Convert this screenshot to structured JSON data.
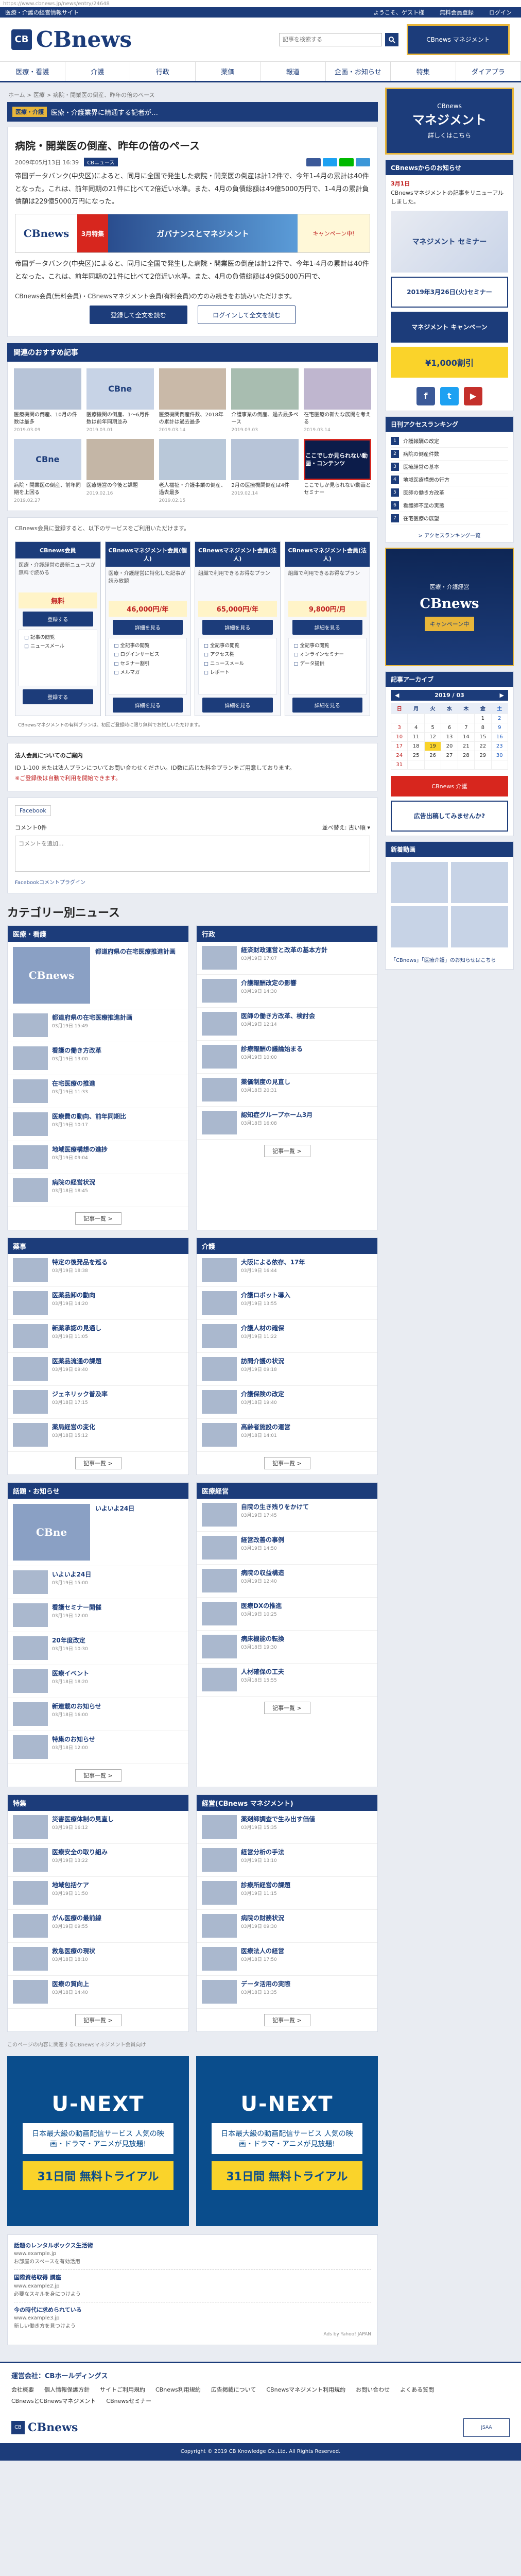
{
  "url": "https://www.cbnews.jp/news/entry/24648",
  "topbar": {
    "left": "医療・介護の経営情報サイト",
    "links": [
      "ようこそ、ゲスト様",
      "無料会員登録",
      "ログイン"
    ]
  },
  "header": {
    "logo": "CBnews",
    "search_placeholder": "記事を検索する",
    "right_banner": "CBnews マネジメント"
  },
  "nav": [
    "医療・看護",
    "介護",
    "行政",
    "薬価",
    "報道",
    "企画・お知らせ",
    "特集",
    "ダイアプラ"
  ],
  "breadcrumb": "ホーム > 医療 > 病院・開業医の倒産、昨年の倍のペース",
  "adbar": {
    "badge": "医療・介護",
    "text": "医療・介護業界に精通する記者が…"
  },
  "article": {
    "title": "病院・開業医の倒産、昨年の倍のペース",
    "date": "2009年05月13日 16:39",
    "tag": "CBニュース",
    "p1": "帝国データバンク(中央区)によると、同月に全国で発生した病院・開業医の倒産は計12件で、今年1-4月の累計は40件となった。これは、前年同期の21件に比べて2倍近い水準。また、4月の負債総額は49億5000万円で、1-4月の累計負債額は229億5000万円になった。",
    "p2": "帝国データバンク(中央区)によると、同月に全国で発生した病院・開業医の倒産は計12件で、今年1-4月の累計は40件となった。これは、前年同期の21件に比べて2倍近い水準。また、4月の負債総額は49億5000万円で、",
    "banner_logo": "CBnews",
    "banner_badge": "3月特集",
    "banner_main": "ガバナンスとマネジメント",
    "banner_extra": "キャンペーン中!",
    "notice": "CBnews会員(無料会員)・CBnewsマネジメント会員(有料会員)の方のみ続きをお読みいただけます。",
    "btn_register": "登録して全文を読む",
    "btn_login": "ログインして全文を読む"
  },
  "recommend": {
    "title": "関連のおすすめ記事",
    "items": [
      {
        "thumb": "",
        "text": "医療機関の倒産、10月の件数は最多",
        "date": "2019.03.09"
      },
      {
        "thumb": "CBne",
        "text": "医療機関の倒産、1〜6月件数は前年同期並み",
        "date": "2019.03.01"
      },
      {
        "thumb": "",
        "text": "医療機関倒産件数、2018年の累計は過去最多",
        "date": "2019.03.14"
      },
      {
        "thumb": "",
        "text": "介護事業の倒産、過去最多ペース",
        "date": "2019.03.03"
      },
      {
        "thumb": "",
        "text": "在宅医療の新たな展開を考える",
        "date": "2019.03.14"
      },
      {
        "thumb": "CBne",
        "text": "病院・開業医の倒産、前年同期を上回る",
        "date": "2019.02.27"
      },
      {
        "thumb": "",
        "text": "医療経営の今後と課題",
        "date": "2019.02.16"
      },
      {
        "thumb": "",
        "text": "老人福祉・介護事業の倒産、過去最多",
        "date": "2019.02.15"
      },
      {
        "thumb": "",
        "text": "2月の医療機関倒産は4件",
        "date": "2019.02.14"
      },
      {
        "thumb": "ここでしか見られない動画・コンテンツ",
        "text": "ここでしか見られない動画とセミナー",
        "date": ""
      }
    ]
  },
  "plans": {
    "intro": "CBnews会員に登録すると、以下のサービスをご利用いただけます。",
    "headers": [
      "CBnews会員",
      "CBnewsマネジメント会員(個人)",
      "CBnewsマネジメント会員(法人)",
      "CBnewsマネジメント会員(法人)"
    ],
    "subs": [
      "医療・介護経営の最新ニュースが無料で読める",
      "医療・介護経営に特化した記事が読み放題",
      "組織で利用できるお得なプラン",
      "組織で利用できるお得なプラン"
    ],
    "prices": [
      "無料",
      "46,000円/年",
      "65,000円/年",
      "9,800円/月"
    ],
    "cta": [
      "登録する",
      "詳細を見る",
      "詳細を見る",
      "詳細を見る"
    ],
    "lists": [
      [
        "記事の閲覧",
        "ニュースメール"
      ],
      [
        "全記事の閲覧",
        "ログインサービス",
        "セミナー割引",
        "メルマガ"
      ],
      [
        "全記事の閲覧",
        "アクセス権",
        "ニュースメール",
        "レポート"
      ],
      [
        "全記事の閲覧",
        "オンラインセミナー",
        "データ提供"
      ]
    ],
    "bottom_note": "CBnewsマネジメントの有料プランは、初回ご登録時に限り無料でお試しいただけます。"
  },
  "contact": {
    "title": "法人会員についてのご案内",
    "text": "ID 1-100 または法人プランについてお問い合わせください。ID数に応じた料金プランをご用意しております。",
    "note": "※ご登録後は自動で利用を開始できます。"
  },
  "comments": {
    "fb": "Facebook",
    "count": "コメント0件",
    "sort": "並べ替え",
    "sort_val": "古い順",
    "placeholder": "コメントを追加...",
    "plugin": "Facebookコメントプラグイン"
  },
  "categories": {
    "title": "カテゴリー別ニュース",
    "boxes": [
      {
        "name": "医療・看護",
        "feat": "CBnews",
        "items": [
          {
            "t": "都道府県の在宅医療推進計画",
            "d": "03月19日 15:49"
          },
          {
            "t": "看護の働き方改革",
            "d": "03月19日 13:00"
          },
          {
            "t": "在宅医療の推進",
            "d": "03月19日 11:33"
          },
          {
            "t": "医療費の動向、前年同期比",
            "d": "03月19日 10:17"
          },
          {
            "t": "地域医療構想の進捗",
            "d": "03月19日 09:04"
          },
          {
            "t": "病院の経営状況",
            "d": "03月18日 18:45"
          }
        ]
      },
      {
        "name": "行政",
        "feat": "",
        "items": [
          {
            "t": "経済財政運営と改革の基本方針",
            "d": "03月19日 17:07"
          },
          {
            "t": "介護報酬改定の影響",
            "d": "03月19日 14:30"
          },
          {
            "t": "医師の働き方改革、検討会",
            "d": "03月19日 12:14"
          },
          {
            "t": "診療報酬の議論始まる",
            "d": "03月19日 10:00"
          },
          {
            "t": "薬価制度の見直し",
            "d": "03月18日 20:31"
          },
          {
            "t": "認知症グループホーム3月",
            "d": "03月18日 16:08"
          }
        ]
      },
      {
        "name": "薬事",
        "feat": "",
        "items": [
          {
            "t": "特定の後発品を巡る",
            "d": "03月19日 18:38"
          },
          {
            "t": "医薬品卸の動向",
            "d": "03月19日 14:20"
          },
          {
            "t": "新薬承認の見通し",
            "d": "03月19日 11:05"
          },
          {
            "t": "医薬品流通の課題",
            "d": "03月19日 09:40"
          },
          {
            "t": "ジェネリック普及率",
            "d": "03月18日 17:15"
          },
          {
            "t": "薬局経営の変化",
            "d": "03月18日 15:12"
          }
        ]
      },
      {
        "name": "介護",
        "feat": "",
        "items": [
          {
            "t": "大阪による依存、17年",
            "d": "03月19日 16:44"
          },
          {
            "t": "介護ロボット導入",
            "d": "03月19日 13:55"
          },
          {
            "t": "介護人材の確保",
            "d": "03月19日 11:22"
          },
          {
            "t": "訪問介護の状況",
            "d": "03月19日 09:18"
          },
          {
            "t": "介護保険の改定",
            "d": "03月18日 19:40"
          },
          {
            "t": "高齢者施設の運営",
            "d": "03月18日 14:01"
          }
        ]
      },
      {
        "name": "話題・お知らせ",
        "feat": "CBne",
        "items": [
          {
            "t": "いよいよ24日",
            "d": "03月19日 15:00"
          },
          {
            "t": "看護セミナー開催",
            "d": "03月19日 12:00"
          },
          {
            "t": "20年度改定",
            "d": "03月19日 10:30"
          },
          {
            "t": "医療イベント",
            "d": "03月18日 18:20"
          },
          {
            "t": "新連載のお知らせ",
            "d": "03月18日 16:00"
          },
          {
            "t": "特集のお知らせ",
            "d": "03月18日 12:00"
          }
        ]
      },
      {
        "name": "医療経営",
        "feat": "",
        "items": [
          {
            "t": "自院の生き残りをかけて",
            "d": "03月19日 17:45"
          },
          {
            "t": "経営改善の事例",
            "d": "03月19日 14:50"
          },
          {
            "t": "病院の収益構造",
            "d": "03月19日 12:40"
          },
          {
            "t": "医療DXの推進",
            "d": "03月19日 10:25"
          },
          {
            "t": "病床機能の転換",
            "d": "03月18日 19:30"
          },
          {
            "t": "人材確保の工夫",
            "d": "03月18日 15:55"
          }
        ]
      },
      {
        "name": "特集",
        "feat": "",
        "items": [
          {
            "t": "災害医療体制の見直し",
            "d": "03月19日 16:12"
          },
          {
            "t": "医療安全の取り組み",
            "d": "03月19日 13:22"
          },
          {
            "t": "地域包括ケア",
            "d": "03月19日 11:50"
          },
          {
            "t": "がん医療の最前線",
            "d": "03月19日 09:55"
          },
          {
            "t": "救急医療の現状",
            "d": "03月18日 18:10"
          },
          {
            "t": "医療の質向上",
            "d": "03月18日 14:40"
          }
        ]
      },
      {
        "name": "経営(CBnews マネジメント)",
        "feat": "",
        "items": [
          {
            "t": "薬剤師調査で生み出す価値",
            "d": "03月19日 15:35"
          },
          {
            "t": "経営分析の手法",
            "d": "03月19日 13:10"
          },
          {
            "t": "診療所経営の課題",
            "d": "03月19日 11:15"
          },
          {
            "t": "病院の財務状況",
            "d": "03月19日 09:30"
          },
          {
            "t": "医療法人の経営",
            "d": "03月18日 17:50"
          },
          {
            "t": "データ活用の実際",
            "d": "03月18日 13:35"
          }
        ]
      }
    ],
    "more": "記事一覧 >"
  },
  "ad_note": "このページの内容に関連するCBnewsマネジメント会員向け",
  "unext": {
    "logo": "U-NEXT",
    "copy": "日本最大級の動画配信サービス 人気の映画・ドラマ・アニメが見放題!",
    "free": "31日間 無料トライアル"
  },
  "text_ads": [
    {
      "title": "話題のレンタルボックス生活術",
      "url": "www.example.jp",
      "desc": "お部屋のスペースを有効活用"
    },
    {
      "title": "国際資格取得 講座",
      "url": "www.example2.jp",
      "desc": "必要なスキルを身につけよう"
    },
    {
      "title": "今の時代に求められている",
      "url": "www.example3.jp",
      "desc": "新しい働き方を見つけよう"
    }
  ],
  "ad_foot": "Ads by Yahoo! JAPAN",
  "side": {
    "banner1": {
      "l1": "CBnews",
      "l2": "マネジメント",
      "l3": "詳しくはこちら"
    },
    "from_title": "CBnewsからのお知らせ",
    "from_date": "3月1日",
    "from_text": "CBnewsマネジメントの記事をリニューアルしました。",
    "video": "マネジメント セミナー",
    "ban_a": "2019年3月26日(火)セミナー",
    "ban_b": "マネジメント キャンペーン",
    "ban_c": "¥1,000割引",
    "ranking_title": "日刊アクセスランキング",
    "ranking": [
      "介護報酬の改定",
      "病院の倒産件数",
      "医療経営の基本",
      "地域医療構想の行方",
      "医師の働き方改革",
      "看護師不足の実態",
      "在宅医療の展望"
    ],
    "ranking_link": "> アクセスランキング一覧",
    "side_ad": {
      "b1": "医療・介護経営",
      "b2": "CBnews",
      "b3": "キャンペーン中"
    },
    "archive": "記事アーカイブ",
    "cal_month": "2019 / 03",
    "cal_days": [
      "日",
      "月",
      "火",
      "水",
      "木",
      "金",
      "土"
    ],
    "cal_weeks": [
      [
        "",
        "",
        "",
        "",
        "",
        "1",
        "2"
      ],
      [
        "3",
        "4",
        "5",
        "6",
        "7",
        "8",
        "9"
      ],
      [
        "10",
        "11",
        "12",
        "13",
        "14",
        "15",
        "16"
      ],
      [
        "17",
        "18",
        "19",
        "20",
        "21",
        "22",
        "23"
      ],
      [
        "24",
        "25",
        "26",
        "27",
        "28",
        "29",
        "30"
      ],
      [
        "31",
        "",
        "",
        "",
        "",
        "",
        ""
      ]
    ],
    "red_banner": "CBnews 介護",
    "red_banner2": "広告出稿してみませんか?",
    "thumbs_title": "新着動画",
    "links_text": "「CBnews」「医療介護」のお知らせはこちら"
  },
  "footer": {
    "title": "運営会社：CBホールディングス",
    "links": [
      "会社概要",
      "個人情報保護方針",
      "サイトご利用規約",
      "CBnews利用規約",
      "広告掲載について",
      "CBnewsマネジメント利用規約",
      "お問い合わせ",
      "よくある質問",
      "CBnewsとCBnewsマネジメント",
      "CBnewsセミナー"
    ],
    "logo": "CBnews",
    "copyright": "Copyright © 2019 CB Knowledge Co.,Ltd. All Rights Reserved."
  }
}
